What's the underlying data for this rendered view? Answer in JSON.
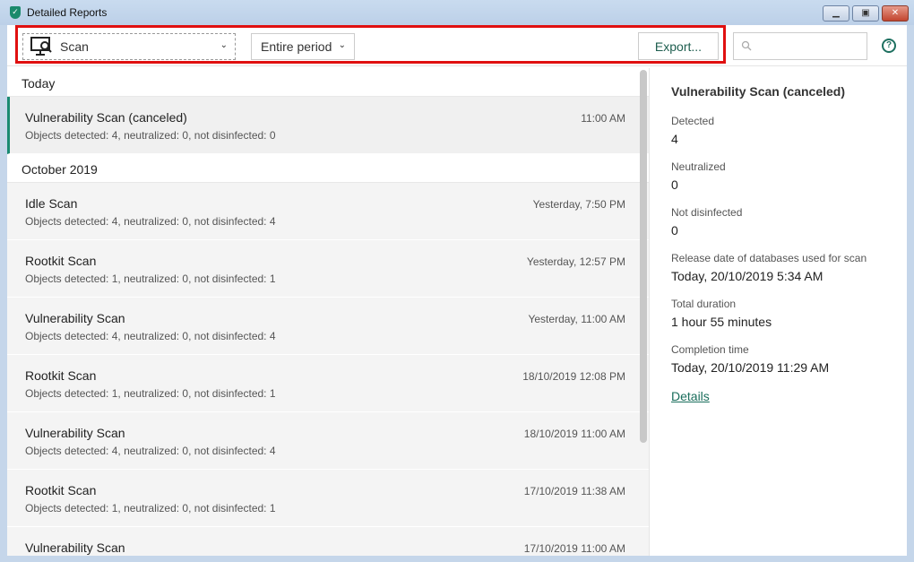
{
  "window": {
    "title": "Detailed Reports"
  },
  "toolbar": {
    "type_select": "Scan",
    "period_select": "Entire period",
    "export_label": "Export...",
    "search_placeholder": ""
  },
  "groups": [
    {
      "label": "Today",
      "items": [
        {
          "name": "Vulnerability Scan (canceled)",
          "desc": "Objects detected: 4, neutralized: 0, not disinfected: 0",
          "time": "11:00 AM",
          "selected": true
        }
      ]
    },
    {
      "label": "October 2019",
      "items": [
        {
          "name": "Idle Scan",
          "desc": "Objects detected: 4, neutralized: 0, not disinfected: 4",
          "time": "Yesterday, 7:50 PM"
        },
        {
          "name": "Rootkit Scan",
          "desc": "Objects detected: 1, neutralized: 0, not disinfected: 1",
          "time": "Yesterday, 12:57 PM"
        },
        {
          "name": "Vulnerability Scan",
          "desc": "Objects detected: 4, neutralized: 0, not disinfected: 4",
          "time": "Yesterday, 11:00 AM"
        },
        {
          "name": "Rootkit Scan",
          "desc": "Objects detected: 1, neutralized: 0, not disinfected: 1",
          "time": "18/10/2019 12:08 PM"
        },
        {
          "name": "Vulnerability Scan",
          "desc": "Objects detected: 4, neutralized: 0, not disinfected: 4",
          "time": "18/10/2019 11:00 AM"
        },
        {
          "name": "Rootkit Scan",
          "desc": "Objects detected: 1, neutralized: 0, not disinfected: 1",
          "time": "17/10/2019 11:38 AM"
        },
        {
          "name": "Vulnerability Scan",
          "desc": "",
          "time": "17/10/2019 11:00 AM"
        }
      ]
    }
  ],
  "detail": {
    "title": "Vulnerability Scan (canceled)",
    "fields": [
      {
        "label": "Detected",
        "value": "4"
      },
      {
        "label": "Neutralized",
        "value": "0"
      },
      {
        "label": "Not disinfected",
        "value": "0"
      },
      {
        "label": "Release date of databases used for scan",
        "value": "Today, 20/10/2019 5:34 AM"
      },
      {
        "label": "Total duration",
        "value": "1 hour 55 minutes"
      },
      {
        "label": "Completion time",
        "value": "Today, 20/10/2019 11:29 AM"
      }
    ],
    "link": "Details"
  }
}
